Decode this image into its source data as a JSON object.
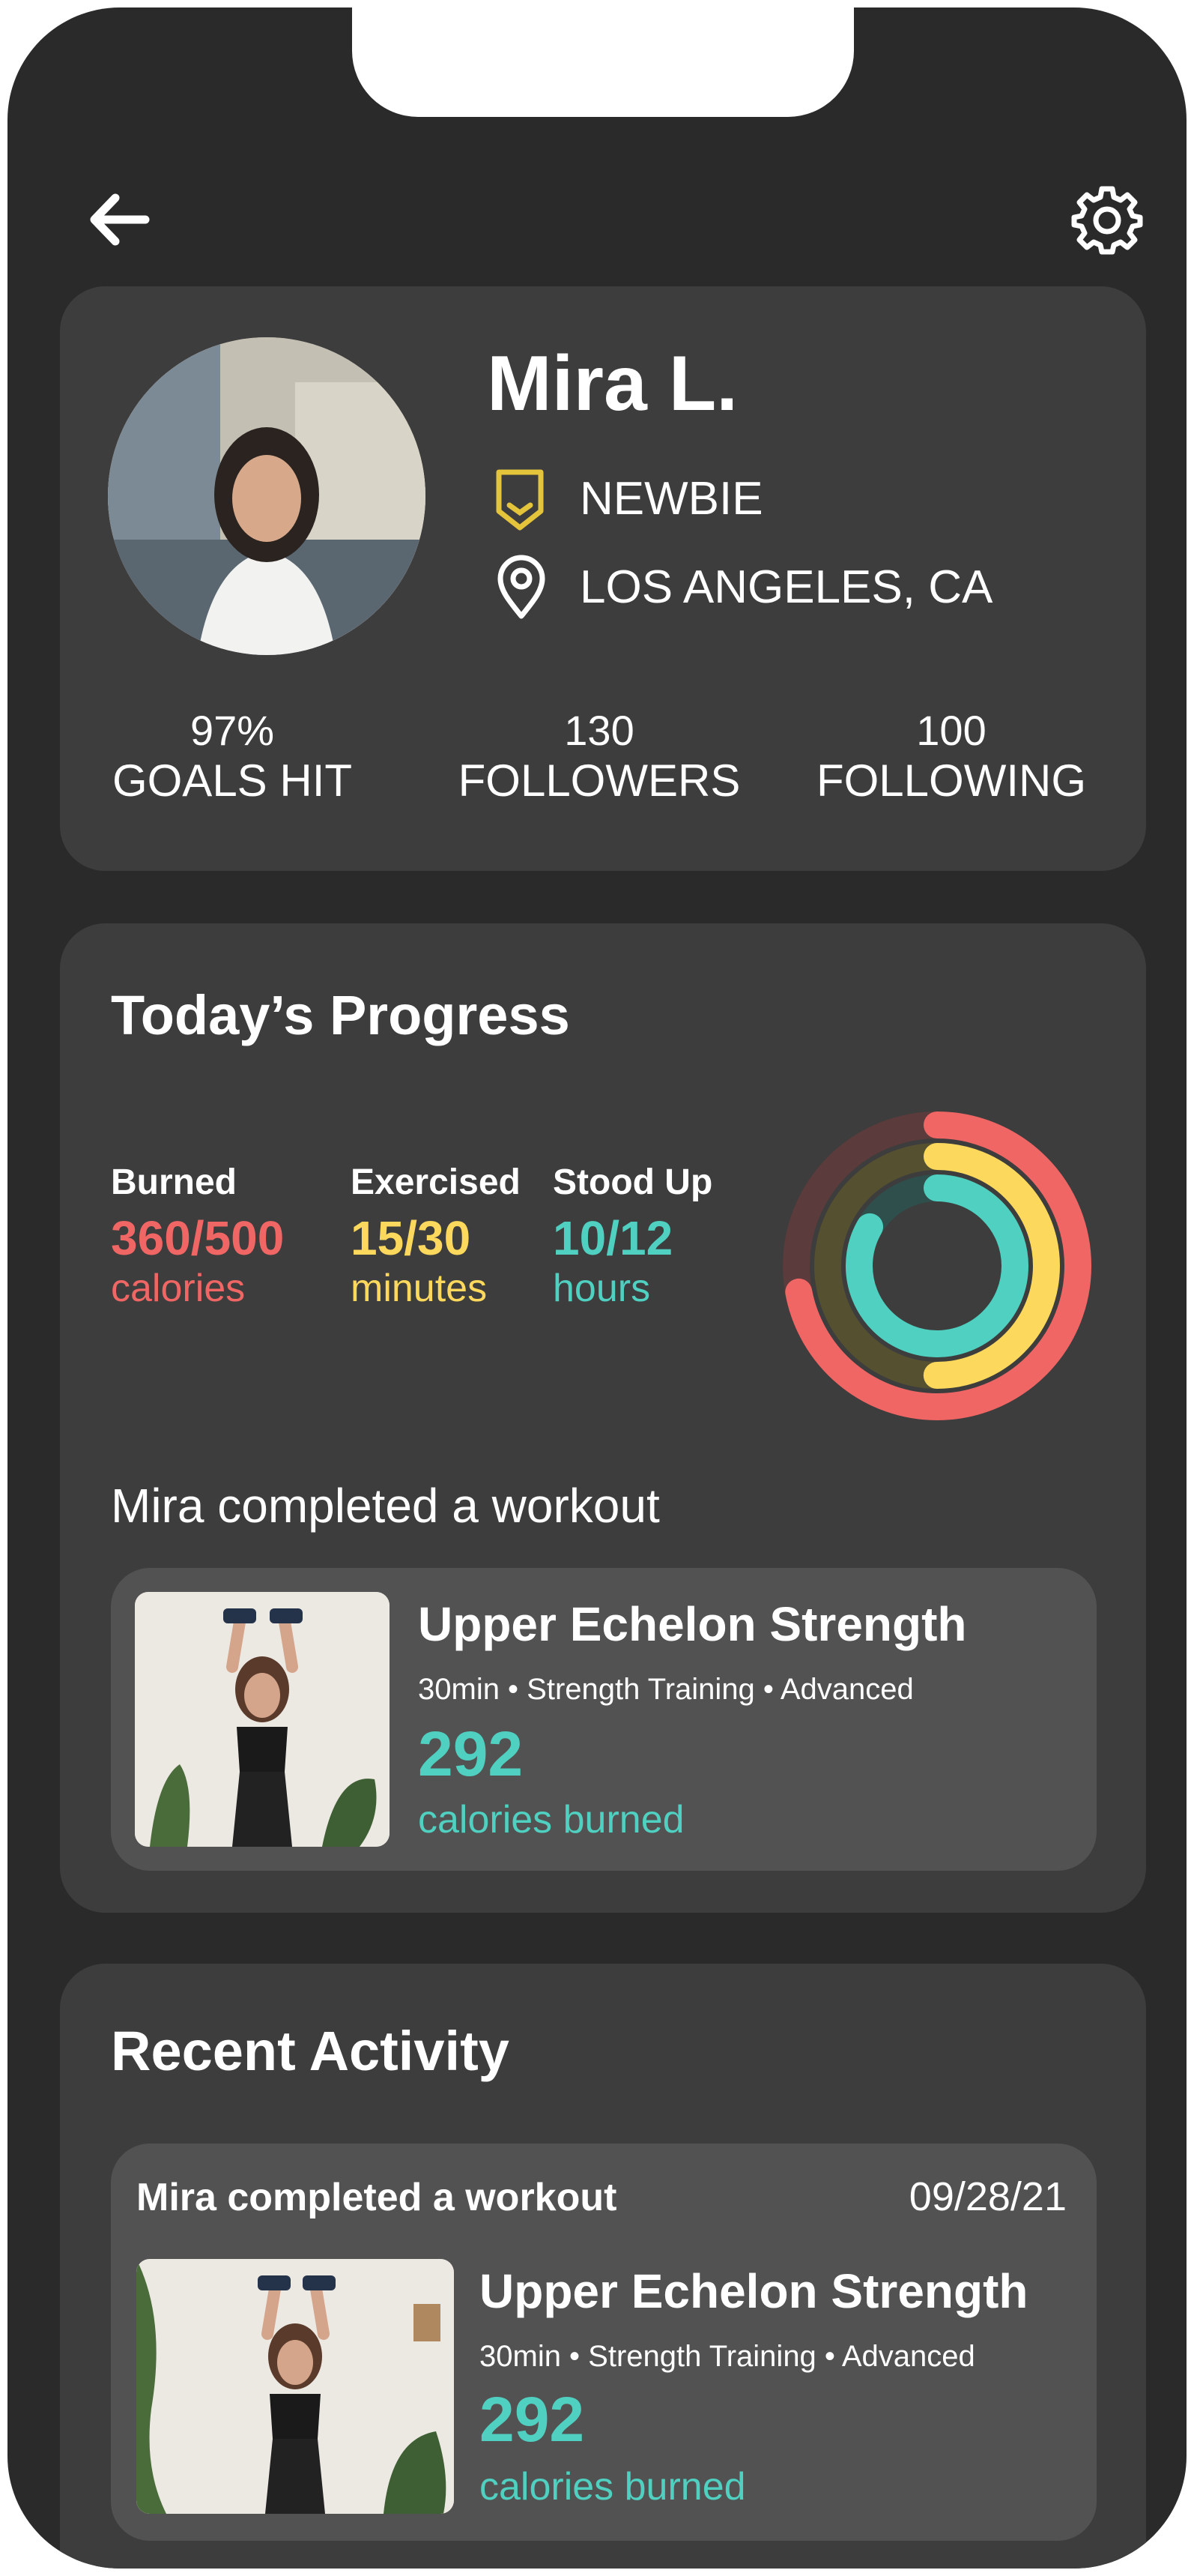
{
  "colors": {
    "background": "#2a2a2a",
    "card": "#3d3d3d",
    "inner_card": "#525252",
    "calories": "#f06664",
    "minutes": "#fcd95c",
    "hours": "#4fd0c0",
    "badge": "#e3c43a"
  },
  "header": {
    "back_icon": "arrow-left-icon",
    "settings_icon": "gear-icon"
  },
  "profile": {
    "name": "Mira L.",
    "rank": "NEWBIE",
    "location": "LOS ANGELES, CA",
    "stats": [
      {
        "value": "97%",
        "label": "GOALS HIT"
      },
      {
        "value": "130",
        "label": "FOLLOWERS"
      },
      {
        "value": "100",
        "label": "FOLLOWING"
      }
    ]
  },
  "progress": {
    "title": "Today’s Progress",
    "metrics": [
      {
        "label": "Burned",
        "value": "360/500",
        "unit": "calories",
        "fraction": 0.72
      },
      {
        "label": "Exercised",
        "value": "15/30",
        "unit": "minutes",
        "fraction": 0.5
      },
      {
        "label": "Stood Up",
        "value": "10/12",
        "unit": "hours",
        "fraction": 0.8333
      }
    ],
    "completed_text": "Mira completed a workout",
    "workout": {
      "title": "Upper Echelon Strength",
      "meta": "30min • Strength Training • Advanced",
      "calories": "292",
      "calories_label": "calories burned"
    }
  },
  "recent": {
    "title": "Recent Activity",
    "items": [
      {
        "text": "Mira completed a workout",
        "date": "09/28/21",
        "title": "Upper Echelon Strength",
        "meta": "30min • Strength Training • Advanced",
        "calories": "292",
        "calories_label": "calories burned"
      }
    ]
  }
}
